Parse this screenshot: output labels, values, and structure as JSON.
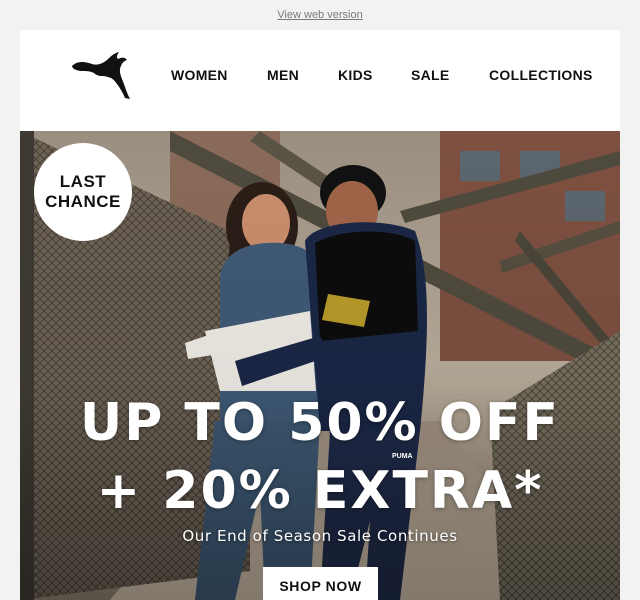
{
  "preheader": {
    "view_web_version": "View web version"
  },
  "brand": {
    "logo_icon": "puma-cat-logo-icon"
  },
  "nav": {
    "items": [
      {
        "label": "WOMEN"
      },
      {
        "label": "MEN"
      },
      {
        "label": "KIDS"
      },
      {
        "label": "SALE"
      },
      {
        "label": "COLLECTIONS"
      }
    ]
  },
  "hero": {
    "badge": "LAST CHANCE",
    "headline_line1": "UP TO 50% OFF",
    "headline_line2": "+ 20% EXTRA*",
    "subheadline": "Our End of Season Sale Continues",
    "cta_label": "SHOP NOW",
    "hoodie_print": "PUMA"
  },
  "colors": {
    "background": "#f2f2f2",
    "email_bg": "#ffffff",
    "text": "#111111",
    "cta_bg": "#ffffff"
  }
}
